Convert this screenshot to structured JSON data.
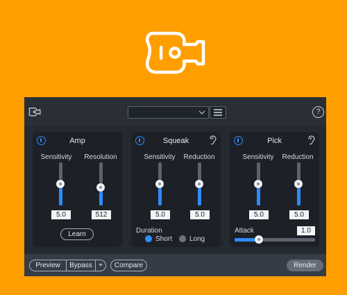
{
  "hero": {
    "icon": "guitar-icon"
  },
  "topbar": {
    "logo_icon": "guitar-icon",
    "preset_value": "",
    "preset_icon": "chevron-down-icon",
    "menu_icon": "hamburger-menu-icon",
    "help_label": "?"
  },
  "modules": {
    "amp": {
      "title": "Amp",
      "power_on": true,
      "sensitivity": {
        "label": "Sensitivity",
        "value": "5.0",
        "level": 0.5
      },
      "resolution": {
        "label": "Resolution",
        "value": "512",
        "level": 0.42
      },
      "learn_label": "Learn"
    },
    "squeak": {
      "title": "Squeak",
      "power_on": true,
      "ear_icon": "ear-icon",
      "sensitivity": {
        "label": "Sensitivity",
        "value": "5.0",
        "level": 0.5
      },
      "reduction": {
        "label": "Reduction",
        "value": "5.0",
        "level": 0.5
      },
      "duration_label": "Duration",
      "duration_options": [
        "Short",
        "Long"
      ],
      "duration_selected": "Short"
    },
    "pick": {
      "title": "Pick",
      "power_on": true,
      "ear_icon": "ear-icon",
      "sensitivity": {
        "label": "Sensitivity",
        "value": "5.0",
        "level": 0.5
      },
      "reduction": {
        "label": "Reduction",
        "value": "5.0",
        "level": 0.5
      },
      "attack_label": "Attack",
      "attack_value": "1.0",
      "attack_level": 0.3
    }
  },
  "bottombar": {
    "preview_label": "Preview",
    "bypass_label": "Bypass",
    "plus_label": "+",
    "compare_label": "Compare",
    "render_label": "Render"
  },
  "colors": {
    "background": "#FF9E00",
    "panel": "#252a31",
    "module": "#1d2127",
    "accent": "#2d8cff"
  }
}
